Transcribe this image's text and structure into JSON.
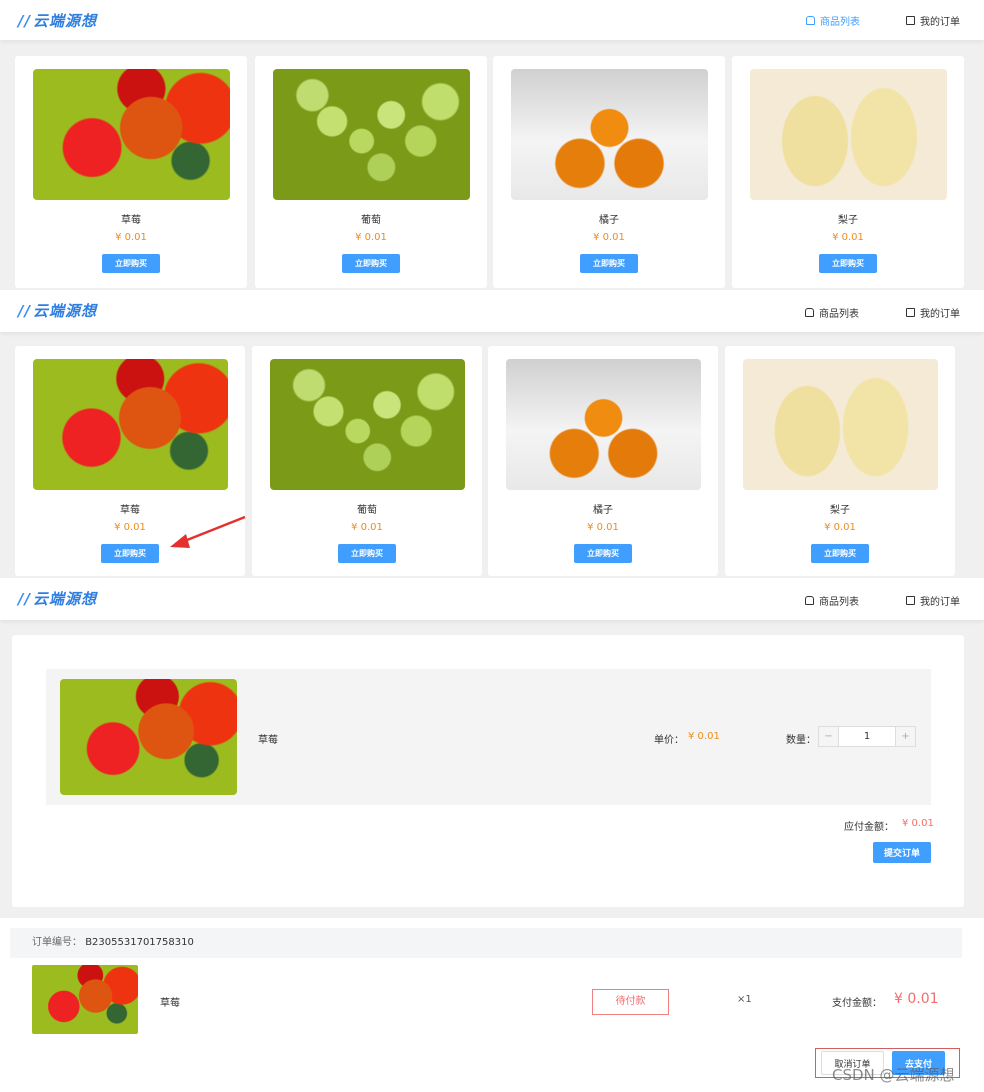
{
  "header": {
    "logo": "云端源想",
    "nav_products": "商品列表",
    "nav_orders": "我的订单"
  },
  "products": [
    {
      "name": "草莓",
      "price": "¥ 0.01",
      "image": "strawberry",
      "buy_label": "立即购买"
    },
    {
      "name": "葡萄",
      "price": "¥ 0.01",
      "image": "grape",
      "buy_label": "立即购买"
    },
    {
      "name": "橘子",
      "price": "¥ 0.01",
      "image": "orange",
      "buy_label": "立即购买"
    },
    {
      "name": "梨子",
      "price": "¥ 0.01",
      "image": "pear",
      "buy_label": "立即购买"
    }
  ],
  "checkout": {
    "product_name": "草莓",
    "unit_price_label": "单价：",
    "unit_price": "¥ 0.01",
    "quantity_label": "数量：",
    "quantity": "1",
    "minus": "−",
    "plus": "+",
    "total_label": "应付金额：",
    "total": "¥ 0.01",
    "submit_label": "提交订单"
  },
  "order": {
    "number_label": "订单编号：",
    "number": "B2305531701758310",
    "product_name": "草莓",
    "status": "待付款",
    "quantity": "×1",
    "pay_label": "支付金额：",
    "pay_amount": "¥ 0.01",
    "cancel_label": "取消订单",
    "pay_button": "去支付"
  },
  "watermark": "CSDN @云端源想",
  "colors": {
    "accent": "#409eff",
    "price": "#f08c1a",
    "alert": "#f56c6c"
  }
}
